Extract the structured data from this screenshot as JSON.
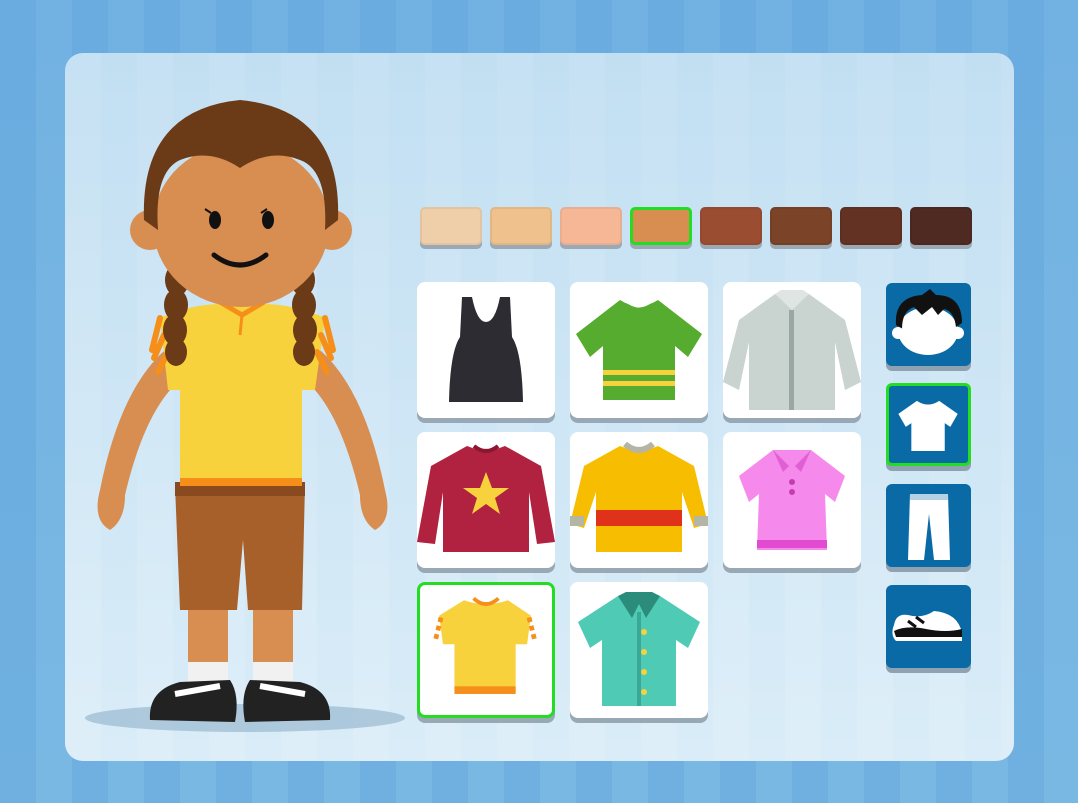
{
  "game": {
    "screen": "character-creator",
    "skin_tones": [
      {
        "color": "#efcfa9",
        "selected": false
      },
      {
        "color": "#efc18c",
        "selected": false
      },
      {
        "color": "#f6b797",
        "selected": false
      },
      {
        "color": "#d88d51",
        "selected": true
      },
      {
        "color": "#9b4d32",
        "selected": false
      },
      {
        "color": "#7b4327",
        "selected": false
      },
      {
        "color": "#633223",
        "selected": false
      },
      {
        "color": "#4f2a22",
        "selected": false
      }
    ],
    "outfit_items": [
      {
        "name": "black-tank-top",
        "icon": "tank-top-icon",
        "selected": false
      },
      {
        "name": "green-striped-tshirt",
        "icon": "tshirt-icon",
        "selected": false
      },
      {
        "name": "grey-button-shirt",
        "icon": "dress-shirt-icon",
        "selected": false
      },
      {
        "name": "red-star-sweater",
        "icon": "sweater-icon",
        "selected": false
      },
      {
        "name": "yellow-striped-sweater",
        "icon": "sweater-icon",
        "selected": false
      },
      {
        "name": "pink-polo",
        "icon": "polo-icon",
        "selected": false
      },
      {
        "name": "yellow-ruffle-top",
        "icon": "blouse-icon",
        "selected": true
      },
      {
        "name": "teal-button-shirt",
        "icon": "shirt-icon",
        "selected": false
      }
    ],
    "categories": [
      {
        "name": "hair",
        "icon": "hair-icon",
        "selected": false
      },
      {
        "name": "tops",
        "icon": "tshirt-icon",
        "selected": true
      },
      {
        "name": "bottoms",
        "icon": "pants-icon",
        "selected": false
      },
      {
        "name": "shoes",
        "icon": "shoe-icon",
        "selected": false
      }
    ],
    "colors": {
      "accent_selected": "#22dd22",
      "category_bg": "#0a6aa6",
      "hair": "#6b3a17",
      "skin": "#d88d51",
      "top": "#f8d23c",
      "shorts": "#a8602a"
    }
  }
}
